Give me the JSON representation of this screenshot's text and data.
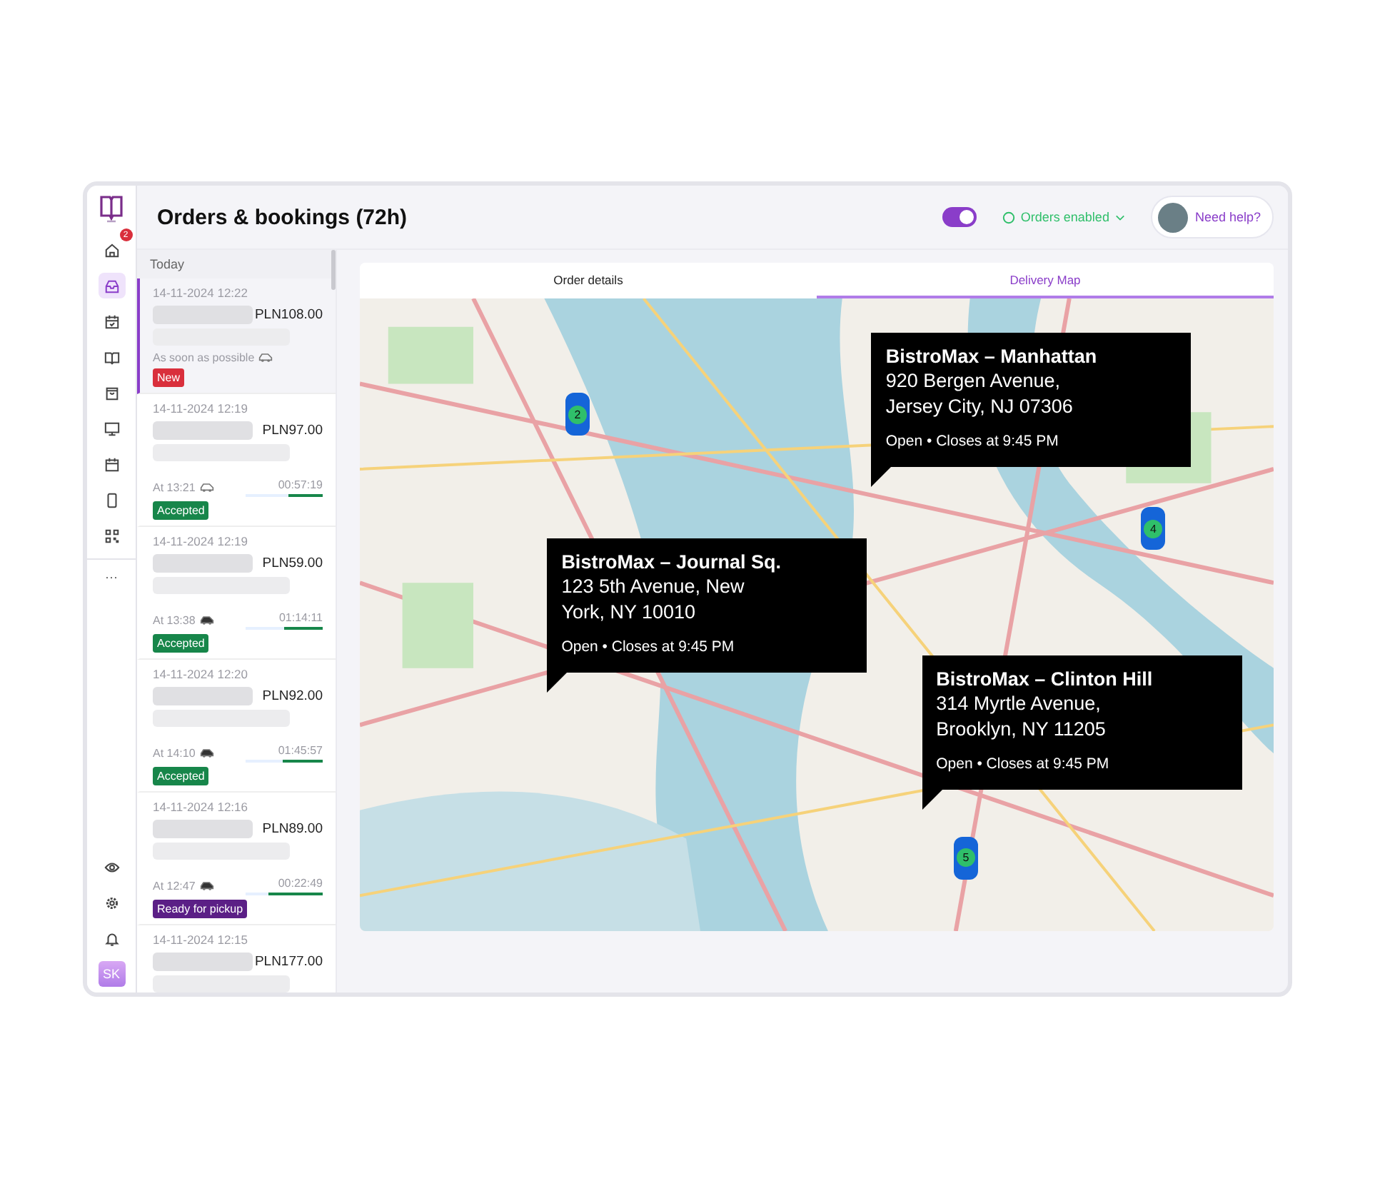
{
  "nav_icons": [
    {
      "selected": false,
      "badge": "2"
    },
    {
      "selected": true
    },
    {
      "selected": false
    },
    {
      "selected": false
    },
    {
      "selected": false
    },
    {
      "selected": false
    },
    {
      "selected": false
    },
    {
      "selected": false
    },
    {
      "selected": false
    }
  ],
  "more_label": "···",
  "bottom_icons": [
    {
      "selected": false
    },
    {
      "selected": false
    },
    {
      "selected": false
    }
  ],
  "user_initials": "SK",
  "header": {
    "title": "Orders & bookings (72h)",
    "toggle_on": true,
    "orders_status": "Orders enabled",
    "help": "Need help?"
  },
  "orders": {
    "group": "Today",
    "items": [
      {
        "date": "14-11-2024 12:22",
        "price": "PLN108.00",
        "time": "As soon as possible",
        "status": "New",
        "kind": "new",
        "selected": true
      },
      {
        "date": "14-11-2024 12:19",
        "price": "PLN97.00",
        "time": "At 13:21",
        "timer": "00:57:19",
        "level": 0.45,
        "status": "Accepted",
        "kind": "accepted",
        "selected": false
      },
      {
        "date": "14-11-2024 12:19",
        "price": "PLN59.00",
        "time": "At 13:38",
        "timer": "01:14:11",
        "level": 0.5,
        "status": "Accepted",
        "kind": "accepted",
        "selected": false
      },
      {
        "date": "14-11-2024 12:20",
        "price": "PLN92.00",
        "time": "At 14:10",
        "timer": "01:45:57",
        "level": 0.52,
        "status": "Accepted",
        "kind": "accepted",
        "selected": false
      },
      {
        "date": "14-11-2024 12:16",
        "price": "PLN89.00",
        "time": "At 12:47",
        "timer": "00:22:49",
        "level": 0.7,
        "status": "Ready for pickup",
        "kind": "ready",
        "selected": false
      },
      {
        "date": "14-11-2024 12:15",
        "price": "PLN177.00",
        "selected": false
      }
    ]
  },
  "tabs": [
    {
      "label": "Order details",
      "selected": false
    },
    {
      "label": "Delivery Map",
      "selected": true
    }
  ],
  "map": {
    "callouts": [
      {
        "title": "BistroMax – Manhattan",
        "address_lines": [
          "920 Bergen Avenue,",
          "Jersey City, NJ 07306"
        ],
        "hours": "Open • Closes at 9:45 PM"
      },
      {
        "title": "BistroMax – Journal Sq.",
        "address_lines": [
          "123 5th Avenue, New",
          "York, NY 10010"
        ],
        "hours": "Open • Closes at 9:45 PM"
      },
      {
        "title": "BistroMax – Clinton Hill",
        "address_lines": [
          "314 Myrtle Avenue,",
          "Brooklyn, NY 11205"
        ],
        "hours": "Open • Closes at 9:45 PM"
      }
    ],
    "cars": [
      "2",
      "4",
      "5"
    ]
  }
}
